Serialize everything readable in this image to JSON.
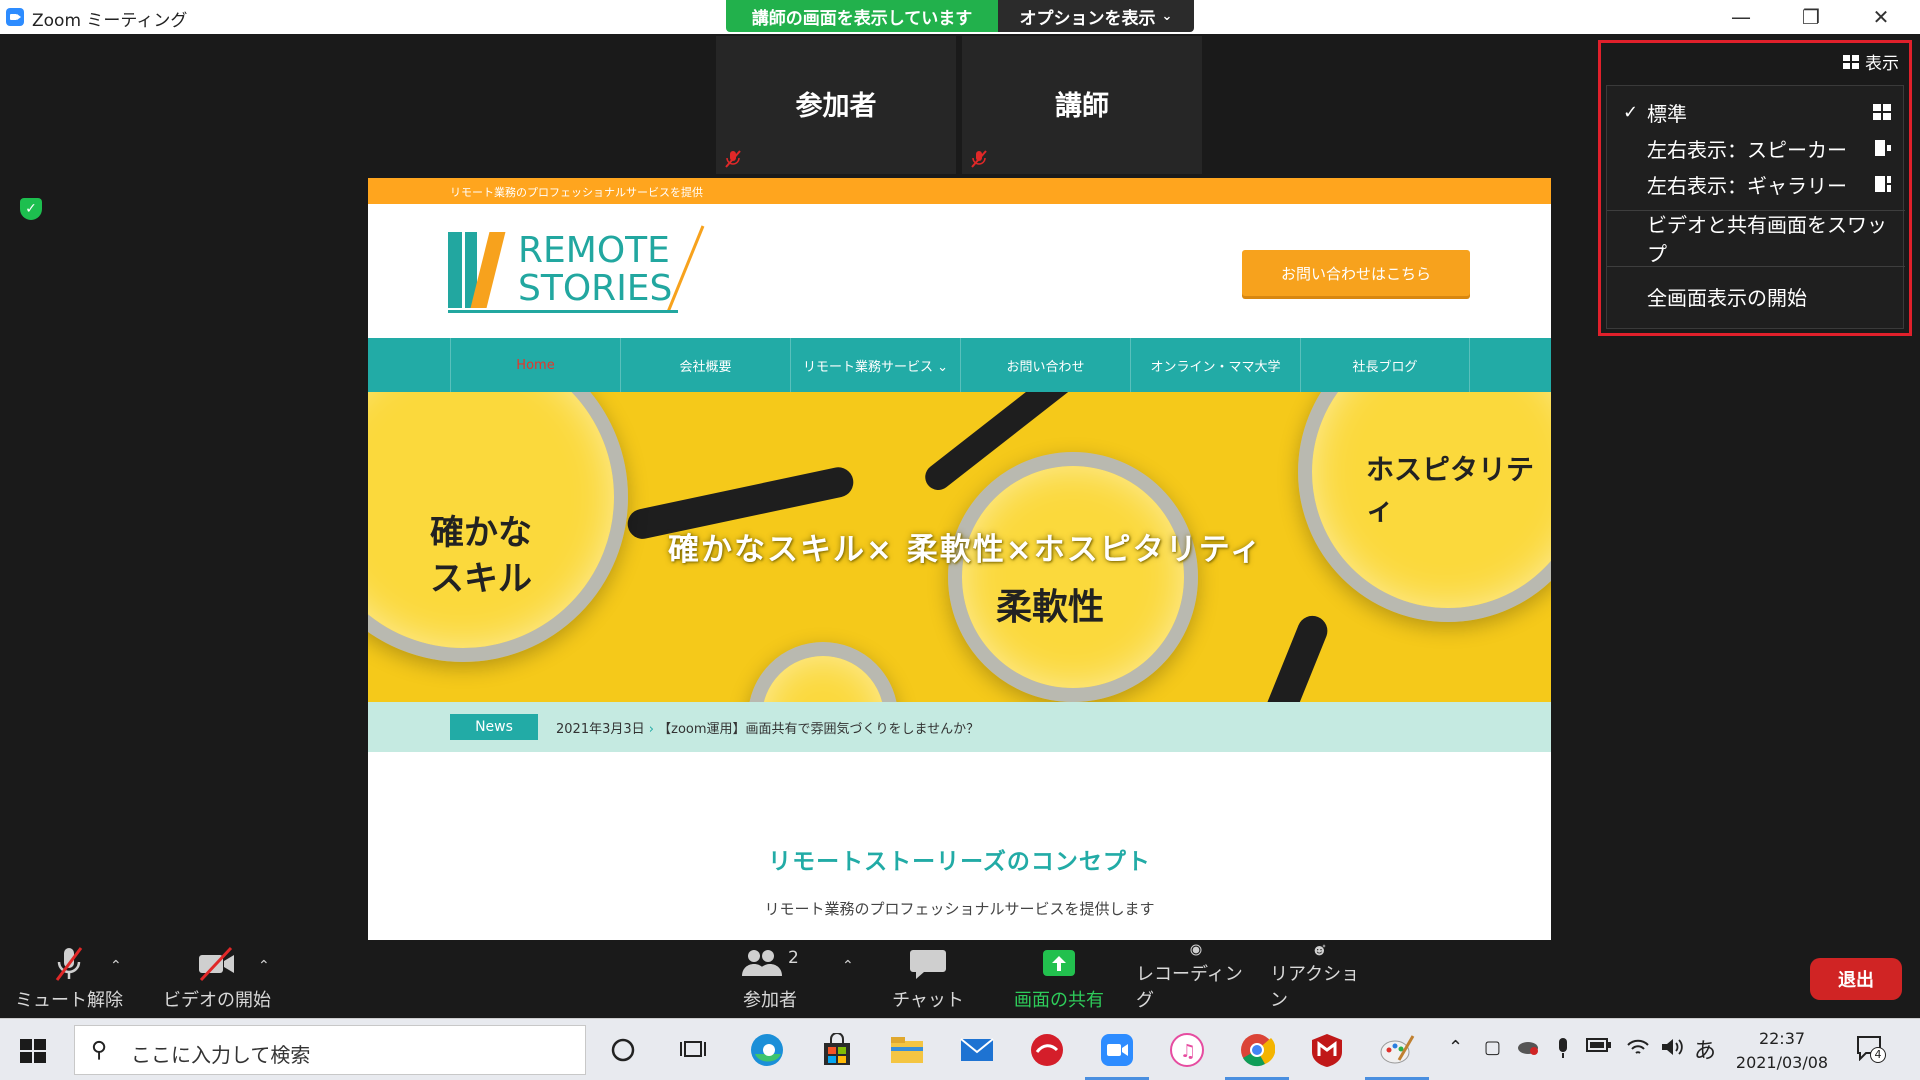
{
  "window": {
    "title": "Zoom ミーティング",
    "minimize": "—",
    "restore": "❐",
    "close": "✕"
  },
  "share_banner": {
    "presenter": "講師",
    "text": " の画面を表示しています",
    "options": "オプションを表示"
  },
  "video_tiles": [
    {
      "name": "参加者"
    },
    {
      "name": "講師"
    }
  ],
  "view_menu": {
    "button_label": "表示",
    "items": [
      {
        "label": "標準",
        "checked": true
      },
      {
        "label": "左右表示：スピーカー"
      },
      {
        "label": "左右表示：ギャラリー"
      },
      {
        "label": "ビデオと共有画面をスワップ"
      },
      {
        "label": "全画面表示の開始"
      }
    ]
  },
  "website": {
    "top_strip": "リモート業務のプロフェッショナルサービスを提供",
    "logo_line1": "REMOTE",
    "logo_line2": "STORIES",
    "contact_button": "お問い合わせはこちら",
    "nav": [
      "Home",
      "会社概要",
      "リモート業務サービス ⌄",
      "お問い合わせ",
      "オンライン・ママ大学",
      "社長ブログ"
    ],
    "hero": {
      "title": "確かなスキル× 柔軟性×ホスピタリティ",
      "left": "確かな\nスキル",
      "center": "柔軟性",
      "right": "ホスピタリティ"
    },
    "news_badge": "News",
    "news_date": "2021年3月3日",
    "news_title": "【zoom運用】画面共有で雰囲気づくりをしませんか？",
    "concept_title": "リモートストーリーズのコンセプト",
    "concept_sub": "リモート業務のプロフェッショナルサービスを提供します",
    "colors": {
      "orange": "#ffa51e",
      "teal": "#22aba6",
      "mint": "#c5eae1",
      "yellow": "#f5c91a"
    }
  },
  "toolbar": {
    "mute": "ミュート解除",
    "video": "ビデオの開始",
    "participants": "参加者",
    "participants_count": "2",
    "chat": "チャット",
    "share": "画面の共有",
    "record": "レコーディング",
    "reactions": "リアクション",
    "leave": "退出"
  },
  "taskbar": {
    "search_placeholder": "ここに入力して検索",
    "ime": "あ",
    "time": "22:37",
    "date": "2021/03/08",
    "notification_count": "4"
  }
}
